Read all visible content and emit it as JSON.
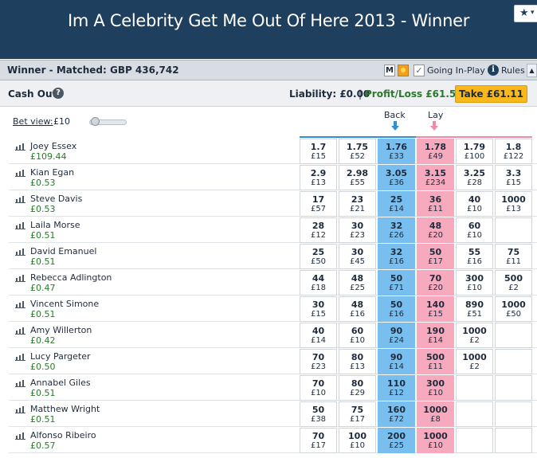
{
  "header": {
    "title": "Im A Celebrity Get Me Out Of Here 2013 - Winner",
    "star_icon": "star-icon"
  },
  "market_bar": {
    "title": "Winner - Matched: GBP 436,742",
    "m_label": "M",
    "going_inplay": "Going In-Play",
    "rules_icon_glyph": "i",
    "rules": "Rules"
  },
  "cashout": {
    "label": "Cash Out",
    "help_glyph": "?",
    "liability": "Liability: £0.00",
    "separator": "|",
    "profit_loss": "Profit/Loss £61.53",
    "take_button": "Take £61.11"
  },
  "betview": {
    "label": "Bet view:",
    "amount": "£10"
  },
  "columns": {
    "back": "Back",
    "lay": "Lay"
  },
  "colors": {
    "banner": "#1f3f5e",
    "back": "#78bff0",
    "lay": "#f7a9bd",
    "take": "#f9b81e",
    "profit": "#2a7a2a"
  },
  "runners": [
    {
      "name": "Joey Essex",
      "pl": "£109.44",
      "prices": [
        [
          "1.7",
          "£15"
        ],
        [
          "1.75",
          "£52"
        ],
        [
          "1.76",
          "£33"
        ],
        [
          "1.78",
          "£49"
        ],
        [
          "1.79",
          "£100"
        ],
        [
          "1.8",
          "£122"
        ]
      ]
    },
    {
      "name": "Kian Egan",
      "pl": "£0.53",
      "prices": [
        [
          "2.9",
          "£13"
        ],
        [
          "2.98",
          "£55"
        ],
        [
          "3.05",
          "£36"
        ],
        [
          "3.15",
          "£234"
        ],
        [
          "3.25",
          "£28"
        ],
        [
          "3.3",
          "£15"
        ]
      ]
    },
    {
      "name": "Steve Davis",
      "pl": "£0.53",
      "prices": [
        [
          "17",
          "£57"
        ],
        [
          "23",
          "£21"
        ],
        [
          "25",
          "£14"
        ],
        [
          "36",
          "£11"
        ],
        [
          "40",
          "£10"
        ],
        [
          "1000",
          "£13"
        ]
      ]
    },
    {
      "name": "Laila Morse",
      "pl": "£0.51",
      "prices": [
        [
          "28",
          "£12"
        ],
        [
          "30",
          "£23"
        ],
        [
          "32",
          "£26"
        ],
        [
          "48",
          "£20"
        ],
        [
          "60",
          "£10"
        ],
        [
          "",
          ""
        ]
      ]
    },
    {
      "name": "David Emanuel",
      "pl": "£0.51",
      "prices": [
        [
          "25",
          "£50"
        ],
        [
          "30",
          "£45"
        ],
        [
          "32",
          "£16"
        ],
        [
          "50",
          "£17"
        ],
        [
          "55",
          "£16"
        ],
        [
          "75",
          "£11"
        ]
      ]
    },
    {
      "name": "Rebecca Adlington",
      "pl": "£0.47",
      "prices": [
        [
          "44",
          "£18"
        ],
        [
          "48",
          "£25"
        ],
        [
          "50",
          "£71"
        ],
        [
          "70",
          "£20"
        ],
        [
          "300",
          "£10"
        ],
        [
          "500",
          "£2"
        ]
      ]
    },
    {
      "name": "Vincent Simone",
      "pl": "£0.51",
      "prices": [
        [
          "30",
          "£15"
        ],
        [
          "48",
          "£16"
        ],
        [
          "50",
          "£16"
        ],
        [
          "140",
          "£15"
        ],
        [
          "890",
          "£51"
        ],
        [
          "1000",
          "£50"
        ]
      ]
    },
    {
      "name": "Amy Willerton",
      "pl": "£0.42",
      "prices": [
        [
          "40",
          "£14"
        ],
        [
          "60",
          "£10"
        ],
        [
          "90",
          "£24"
        ],
        [
          "190",
          "£14"
        ],
        [
          "1000",
          "£2"
        ],
        [
          "",
          ""
        ]
      ]
    },
    {
      "name": "Lucy Pargeter",
      "pl": "£0.50",
      "prices": [
        [
          "70",
          "£23"
        ],
        [
          "80",
          "£13"
        ],
        [
          "90",
          "£14"
        ],
        [
          "500",
          "£11"
        ],
        [
          "1000",
          "£2"
        ],
        [
          "",
          ""
        ]
      ]
    },
    {
      "name": "Annabel Giles",
      "pl": "£0.51",
      "prices": [
        [
          "70",
          "£10"
        ],
        [
          "80",
          "£29"
        ],
        [
          "110",
          "£12"
        ],
        [
          "300",
          "£10"
        ],
        [
          "",
          ""
        ],
        [
          "",
          ""
        ]
      ]
    },
    {
      "name": "Matthew Wright",
      "pl": "£0.51",
      "prices": [
        [
          "50",
          "£38"
        ],
        [
          "75",
          "£17"
        ],
        [
          "160",
          "£72"
        ],
        [
          "1000",
          "£8"
        ],
        [
          "",
          ""
        ],
        [
          "",
          ""
        ]
      ]
    },
    {
      "name": "Alfonso Ribeiro",
      "pl": "£0.57",
      "prices": [
        [
          "70",
          "£17"
        ],
        [
          "100",
          "£10"
        ],
        [
          "200",
          "£25"
        ],
        [
          "1000",
          "£10"
        ],
        [
          "",
          ""
        ],
        [
          "",
          ""
        ]
      ]
    }
  ]
}
